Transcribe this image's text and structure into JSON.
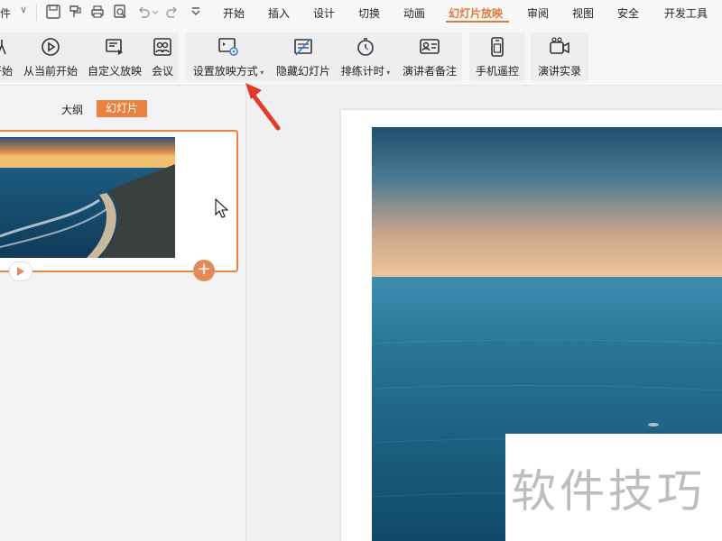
{
  "menubar": {
    "file_label": "件",
    "tabs": [
      "开始",
      "插入",
      "设计",
      "切换",
      "动画",
      "幻灯片放映",
      "审阅",
      "视图",
      "安全",
      "开发工具"
    ],
    "active_tab": "幻灯片放映"
  },
  "ribbon": {
    "buttons": [
      {
        "label": "开始",
        "icon": "slideshow-start-icon"
      },
      {
        "label": "从当前开始",
        "icon": "play-circle-icon"
      },
      {
        "label": "自定义放映",
        "icon": "custom-show-icon"
      },
      {
        "label": "会议",
        "icon": "meeting-icon"
      },
      {
        "label": "设置放映方式",
        "icon": "settings-screen-icon",
        "has_dropdown": true
      },
      {
        "label": "隐藏幻灯片",
        "icon": "hide-slide-icon"
      },
      {
        "label": "排练计时",
        "icon": "stopwatch-icon",
        "has_dropdown": true
      },
      {
        "label": "演讲者备注",
        "icon": "speaker-notes-icon"
      },
      {
        "label": "手机遥控",
        "icon": "phone-remote-icon"
      },
      {
        "label": "演讲实录",
        "icon": "record-camera-icon"
      }
    ]
  },
  "left_panel": {
    "outline_tab": "大纲",
    "slides_tab": "幻灯片",
    "active_tab": "幻灯片"
  },
  "slide": {
    "watermark_text": "软件技巧"
  },
  "colors": {
    "accent": "#e9813f",
    "active_tab_text": "#e07a3a"
  }
}
